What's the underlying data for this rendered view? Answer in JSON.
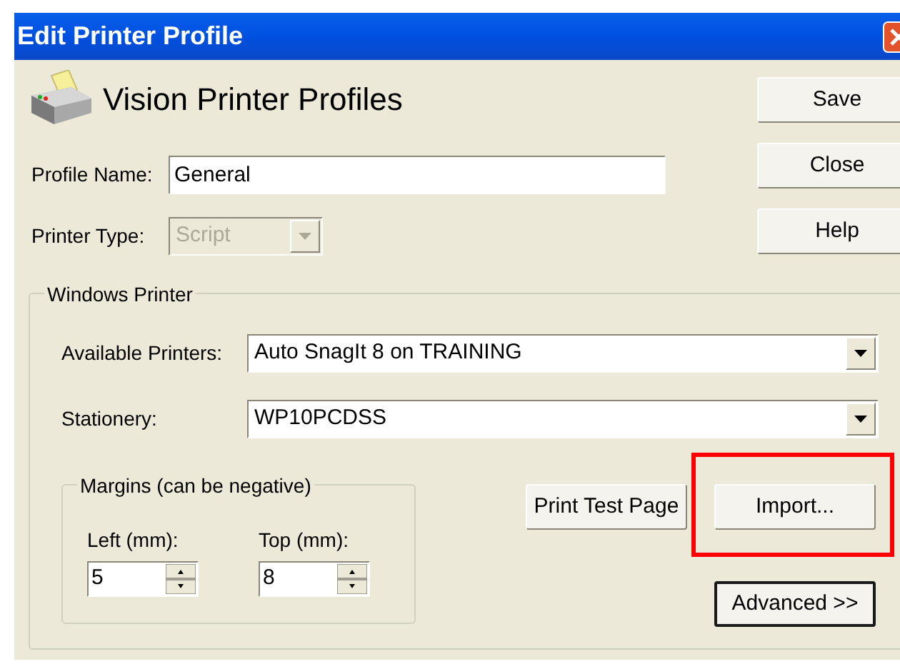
{
  "window": {
    "title": "Edit Printer Profile"
  },
  "header": {
    "title": "Vision Printer Profiles"
  },
  "side_buttons": [
    {
      "label": "Save",
      "default": false
    },
    {
      "label": "Close",
      "default": false
    },
    {
      "label": "Help",
      "default": false
    }
  ],
  "profile_name": {
    "label": "Profile Name:",
    "value": "General"
  },
  "printer_type": {
    "label": "Printer Type:",
    "value": "Script",
    "disabled": true
  },
  "windows_printer": {
    "legend": "Windows Printer",
    "available_printers": {
      "label": "Available Printers:",
      "value": "Auto SnagIt 8 on TRAINING"
    },
    "stationery": {
      "label": "Stationery:",
      "value": "WP10PCDSS"
    },
    "margins": {
      "legend": "Margins (can be negative)",
      "fields": [
        {
          "label": "Left (mm):",
          "value": "5"
        },
        {
          "label": "Top (mm):",
          "value": "8"
        }
      ]
    },
    "buttons": [
      {
        "label": "Print Test Page",
        "default": false,
        "highlighted": false
      },
      {
        "label": "Import...",
        "default": false,
        "highlighted": true
      },
      {
        "label": "Advanced >>",
        "default": true,
        "highlighted": false
      }
    ]
  }
}
